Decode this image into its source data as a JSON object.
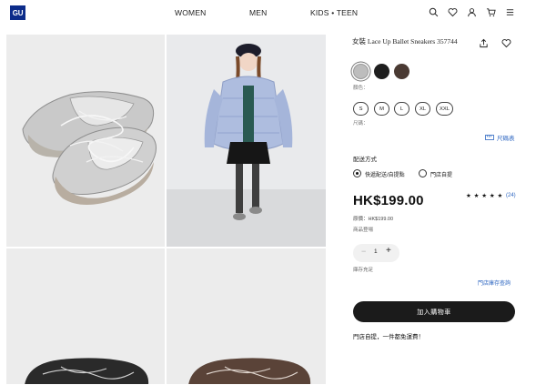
{
  "header": {
    "logo": "GU",
    "nav": [
      "WOMEN",
      "MEN",
      "KIDS • TEEN"
    ],
    "icons": [
      "search-icon",
      "heart-icon",
      "user-icon",
      "cart-icon",
      "menu-icon"
    ]
  },
  "gallery": {
    "images": [
      "silver-lace-up-ballet-sneakers",
      "model-wearing-puffer-jacket",
      "black-lace-up-ballet-sneakers",
      "brown-lace-up-ballet-sneakers"
    ]
  },
  "product": {
    "title": "女裝 Lace Up Ballet Sneakers 357744",
    "colors_label": "顏色：",
    "colors": [
      "#bdbdbd",
      "#1e1e1e",
      "#4a3a33"
    ],
    "sizes_label": "尺碼：",
    "sizes": [
      "S",
      "M",
      "L",
      "XL",
      "XXL"
    ],
    "size_chart": "尺碼表",
    "delivery_title": "配送方式",
    "delivery_options": [
      "快遞配送/自提點",
      "門店自提"
    ],
    "price": "HK$199.00",
    "stars": "★ ★ ★ ★ ★",
    "review_count": "(24)",
    "original_price": "原價：HK$199.00",
    "launch_note": "商品登場",
    "quantity": "1",
    "quantity_minus": "−",
    "quantity_plus": "+",
    "stock_note": "庫存充足",
    "store_stock": "門店庫存查詢",
    "add_to_cart": "加入購物車",
    "free_shipping": "門店自提，一件都免運費！"
  }
}
